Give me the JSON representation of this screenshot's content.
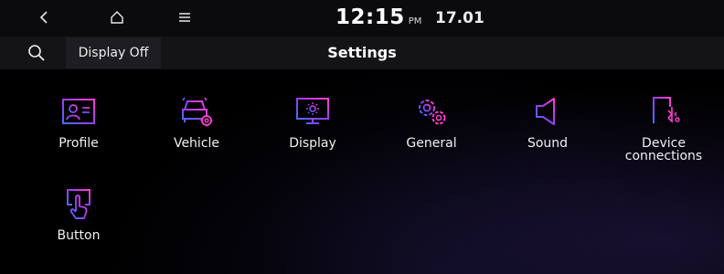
{
  "status_bar": {
    "back_icon": "chevron-left-icon",
    "home_icon": "home-icon",
    "menu_icon": "hamburger-menu-icon",
    "time": "12:15",
    "ampm": "PM",
    "date": "17.01"
  },
  "header": {
    "search_icon": "search-icon",
    "display_off_label": "Display Off",
    "title": "Settings"
  },
  "tiles": [
    {
      "label": "Profile",
      "icon": "profile-card-icon"
    },
    {
      "label": "Vehicle",
      "icon": "vehicle-settings-icon"
    },
    {
      "label": "Display",
      "icon": "display-brightness-icon"
    },
    {
      "label": "General",
      "icon": "gears-icon"
    },
    {
      "label": "Sound",
      "icon": "speaker-icon"
    },
    {
      "label": "Device\nconnections",
      "icon": "phone-connection-icon"
    },
    {
      "label": "Button",
      "icon": "touch-button-icon"
    }
  ],
  "colors": {
    "icon_gradient_start": "#4a6bff",
    "icon_gradient_mid": "#9a3cf0",
    "icon_gradient_end": "#ff3fd2",
    "background": "#000000",
    "header_bar": "#141417"
  }
}
